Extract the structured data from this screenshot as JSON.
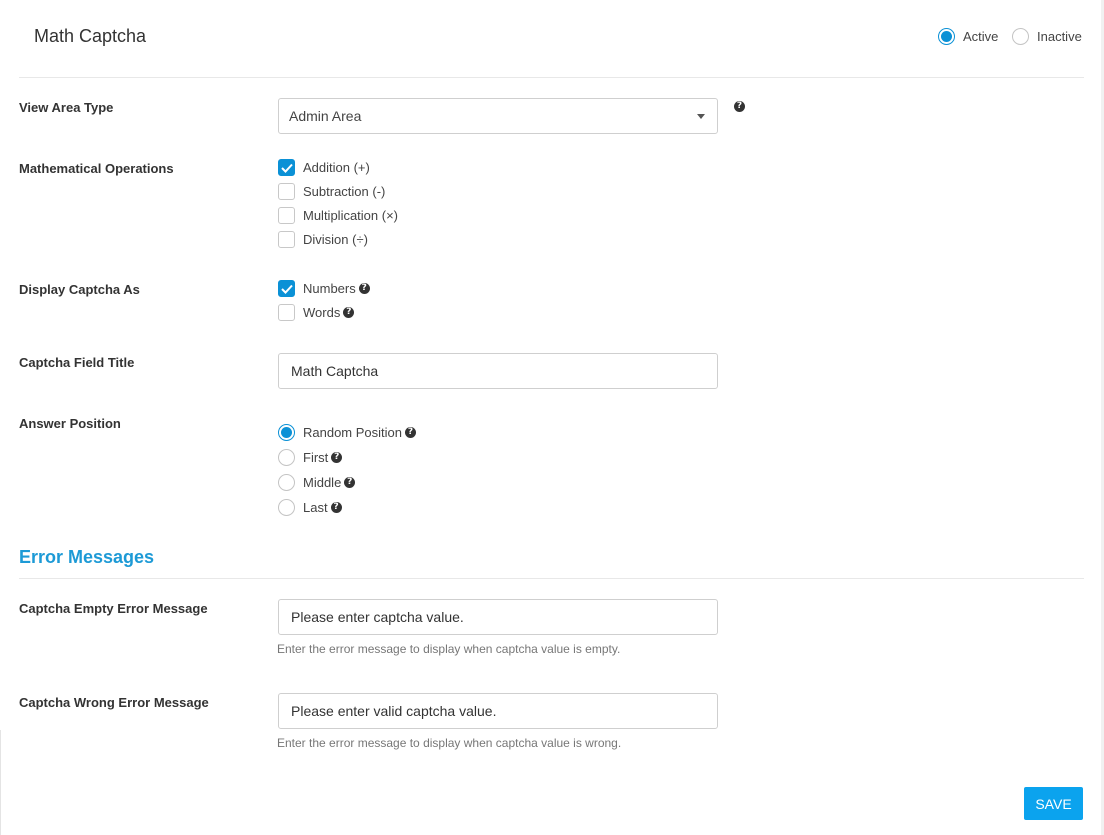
{
  "header": {
    "title": "Math Captcha",
    "status_options": [
      {
        "label": "Active",
        "checked": true
      },
      {
        "label": "Inactive",
        "checked": false
      }
    ]
  },
  "view_area": {
    "label": "View Area Type",
    "selected": "Admin Area"
  },
  "operations": {
    "label": "Mathematical Operations",
    "items": [
      {
        "label": "Addition (+)",
        "checked": true
      },
      {
        "label": "Subtraction (-)",
        "checked": false
      },
      {
        "label": "Multiplication (×)",
        "checked": false
      },
      {
        "label": "Division (÷)",
        "checked": false
      }
    ]
  },
  "display_as": {
    "label": "Display Captcha As",
    "items": [
      {
        "label": "Numbers",
        "checked": true
      },
      {
        "label": "Words",
        "checked": false
      }
    ]
  },
  "field_title": {
    "label": "Captcha Field Title",
    "value": "Math Captcha"
  },
  "answer_position": {
    "label": "Answer Position",
    "items": [
      {
        "label": "Random Position",
        "checked": true
      },
      {
        "label": "First",
        "checked": false
      },
      {
        "label": "Middle",
        "checked": false
      },
      {
        "label": "Last",
        "checked": false
      }
    ]
  },
  "errors": {
    "heading": "Error Messages",
    "empty": {
      "label": "Captcha Empty Error Message",
      "value": "Please enter captcha value.",
      "help": "Enter the error message to display when captcha value is empty."
    },
    "wrong": {
      "label": "Captcha Wrong Error Message",
      "value": "Please enter valid captcha value.",
      "help": "Enter the error message to display when captcha value is wrong."
    }
  },
  "save_label": "SAVE",
  "help_glyph": "?",
  "colors": {
    "accent": "#0b91d6",
    "button": "#0ba3ee",
    "heading": "#1d9ad6"
  }
}
